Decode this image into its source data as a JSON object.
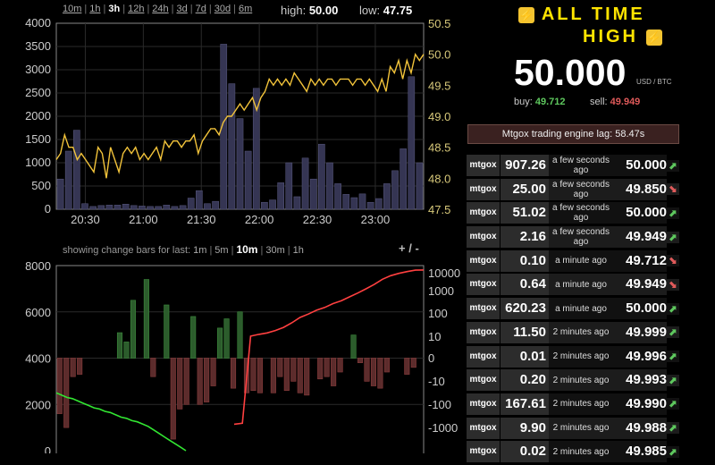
{
  "timeframes": [
    "10m",
    "1h",
    "3h",
    "12h",
    "24h",
    "3d",
    "7d",
    "30d",
    "6m"
  ],
  "active_timeframe": "3h",
  "stats": {
    "high_label": "high:",
    "high": "50.00",
    "low_label": "low:",
    "low": "47.75"
  },
  "change_bars": {
    "label": "showing change bars for last:",
    "options": [
      "1m",
      "5m",
      "10m",
      "30m",
      "1h"
    ],
    "active": "10m",
    "zoom_plus": "+",
    "zoom_sep": "/",
    "zoom_minus": "-"
  },
  "banner": {
    "line1": "ALL TIME",
    "line2": "HIGH",
    "icon": "lightning-bolt-icon",
    "color": "#ffe400"
  },
  "price": {
    "value": "50.000",
    "unit": "USD / BTC",
    "buy_label": "buy:",
    "buy": "49.712",
    "sell_label": "sell:",
    "sell": "49.949"
  },
  "lag": "Mtgox trading engine lag: 58.47s",
  "trades": [
    {
      "ex": "mtgox",
      "amount": "907.26",
      "time": "a few seconds ago",
      "price": "50.000",
      "dir": "up"
    },
    {
      "ex": "mtgox",
      "amount": "25.00",
      "time": "a few seconds ago",
      "price": "49.850",
      "dir": "down"
    },
    {
      "ex": "mtgox",
      "amount": "51.02",
      "time": "a few seconds ago",
      "price": "50.000",
      "dir": "up"
    },
    {
      "ex": "mtgox",
      "amount": "2.16",
      "time": "a few seconds ago",
      "price": "49.949",
      "dir": "up"
    },
    {
      "ex": "mtgox",
      "amount": "0.10",
      "time": "a minute ago",
      "price": "49.712",
      "dir": "down"
    },
    {
      "ex": "mtgox",
      "amount": "0.64",
      "time": "a minute ago",
      "price": "49.949",
      "dir": "down"
    },
    {
      "ex": "mtgox",
      "amount": "620.23",
      "time": "a minute ago",
      "price": "50.000",
      "dir": "up"
    },
    {
      "ex": "mtgox",
      "amount": "11.50",
      "time": "2 minutes ago",
      "price": "49.999",
      "dir": "up"
    },
    {
      "ex": "mtgox",
      "amount": "0.01",
      "time": "2 minutes ago",
      "price": "49.996",
      "dir": "up"
    },
    {
      "ex": "mtgox",
      "amount": "0.20",
      "time": "2 minutes ago",
      "price": "49.993",
      "dir": "up"
    },
    {
      "ex": "mtgox",
      "amount": "167.61",
      "time": "2 minutes ago",
      "price": "49.990",
      "dir": "up"
    },
    {
      "ex": "mtgox",
      "amount": "9.90",
      "time": "2 minutes ago",
      "price": "49.988",
      "dir": "up"
    },
    {
      "ex": "mtgox",
      "amount": "0.02",
      "time": "2 minutes ago",
      "price": "49.985",
      "dir": "up"
    }
  ],
  "chart_data": [
    {
      "type": "bar",
      "x_ticks": [
        "20:30",
        "21:00",
        "21:30",
        "22:00",
        "22:30",
        "23:00"
      ],
      "x_range": [
        "20:15",
        "23:25"
      ],
      "y_left_ticks": [
        "0",
        "500",
        "1000",
        "1500",
        "2000",
        "2500",
        "3000",
        "3500",
        "4000"
      ],
      "y_left_range": [
        0,
        4000
      ],
      "y_right_ticks": [
        "47.5",
        "48.0",
        "48.5",
        "49.0",
        "49.5",
        "50.0",
        "50.5"
      ],
      "y_right_range": [
        47.5,
        50.5
      ],
      "grid": true,
      "volume_bars": [
        650,
        1250,
        1700,
        120,
        60,
        80,
        90,
        90,
        110,
        80,
        70,
        60,
        60,
        90,
        60,
        80,
        240,
        400,
        120,
        170,
        3550,
        2700,
        1950,
        1250,
        2600,
        150,
        200,
        570,
        1000,
        270,
        1100,
        650,
        1400,
        1000,
        550,
        320,
        250,
        330,
        150,
        230,
        550,
        830,
        1300,
        2850,
        1000
      ],
      "price_line": [
        48.3,
        48.4,
        48.7,
        48.5,
        48.5,
        48.3,
        48.4,
        48.3,
        48.2,
        48.1,
        48.5,
        48.4,
        48.0,
        48.5,
        48.3,
        48.1,
        48.4,
        48.5,
        48.4,
        48.5,
        48.3,
        48.4,
        48.3,
        48.4,
        48.5,
        48.3,
        48.6,
        48.5,
        48.6,
        48.6,
        48.5,
        48.6,
        48.6,
        48.7,
        48.4,
        48.6,
        48.7,
        48.8,
        48.8,
        48.7,
        48.9,
        49.0,
        49.0,
        49.1,
        49.2,
        49.1,
        49.2,
        49.3,
        49.1,
        49.3,
        49.4,
        49.6,
        49.5,
        49.6,
        49.5,
        49.6,
        49.5,
        49.7,
        49.6,
        49.5,
        49.4,
        49.6,
        49.5,
        49.6,
        49.5,
        49.6,
        49.6,
        49.5,
        49.6,
        49.6,
        49.6,
        49.5,
        49.6,
        49.6,
        49.5,
        49.6,
        49.5,
        49.4,
        49.6,
        49.4,
        49.8,
        49.7,
        49.9,
        49.6,
        49.9,
        49.7,
        50.0,
        49.9,
        50.0
      ],
      "volume_color": "#353553",
      "price_color": "#f2c33a"
    },
    {
      "type": "bar",
      "y_left_ticks": [
        "0",
        "2000",
        "4000",
        "6000",
        "8000"
      ],
      "y_left_range": [
        0,
        8000
      ],
      "y_right_ticks": [
        "-1000",
        "-100",
        "-10",
        "0",
        "10",
        "100",
        "1000",
        "10000"
      ],
      "grid": true,
      "change_bars": [
        -2400,
        -3000,
        -800,
        -700,
        0,
        0,
        0,
        0,
        0,
        1100,
        700,
        2500,
        0,
        3400,
        -800,
        0,
        2300,
        -3500,
        -2200,
        -2000,
        1800,
        -2000,
        -1900,
        -1200,
        1300,
        1700,
        -1300,
        2000,
        -1500,
        -1400,
        -1500,
        0,
        -1500,
        -800,
        -1400,
        -1000,
        -1500,
        -1600,
        0,
        -900,
        -800,
        -1200,
        -600,
        0,
        1000,
        -200,
        -1000,
        -1200,
        -1300,
        -600,
        0,
        0,
        -700,
        -400,
        0
      ],
      "up_color": "#2c5c2c",
      "down_color": "#5c2c2c",
      "cumulative_buy": {
        "color": "#32e632",
        "values": [
          2500,
          2400,
          2300,
          2250,
          2150,
          2050,
          1950,
          1850,
          1800,
          1700,
          1650,
          1550,
          1450,
          1400,
          1300,
          1250,
          1150,
          1050,
          900,
          750,
          600,
          450,
          300,
          150,
          0
        ]
      },
      "cumulative_sell": {
        "color": "#ff4040",
        "values": [
          -1000,
          -900,
          10,
          12,
          14,
          18,
          25,
          40,
          70,
          100,
          150,
          200,
          300,
          400,
          600,
          900,
          1400,
          2200,
          3800,
          5500,
          7000,
          8500,
          9800,
          10000
        ]
      }
    }
  ]
}
